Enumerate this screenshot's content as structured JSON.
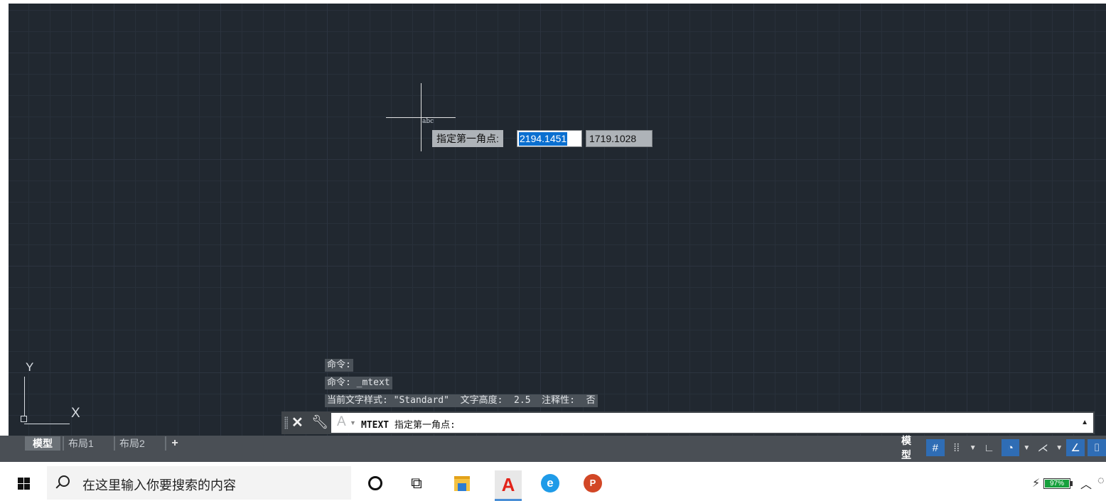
{
  "canvas": {
    "cursor_label": "abc",
    "dynamic_input": {
      "prompt": "指定第一角点:",
      "x_value": "2194.1451",
      "y_value": "1719.1028"
    },
    "ucs": {
      "y_label": "Y",
      "x_label": "X"
    }
  },
  "history": [
    "命令:",
    "命令: _mtext",
    "当前文字样式: \"Standard\"  文字高度:  2.5  注释性:  否"
  ],
  "command_line": {
    "command": "MTEXT",
    "prompt": " 指定第一角点:"
  },
  "layout_tabs": {
    "active": "模型",
    "tabs": [
      "布局1",
      "布局2"
    ],
    "add": "+"
  },
  "status_bar": {
    "model_label": "模型",
    "accent_color": "#2f6db5",
    "icons": [
      "grid-icon",
      "snap-icon",
      "ortho-icon",
      "polar-icon",
      "osnap-track-icon",
      "isodraft-icon"
    ]
  },
  "taskbar": {
    "search_placeholder": "在这里输入你要搜索的内容",
    "battery": "97%",
    "apps": [
      "cortana",
      "task-view",
      "file-explorer",
      "autocad",
      "edge",
      "powerpoint"
    ]
  }
}
